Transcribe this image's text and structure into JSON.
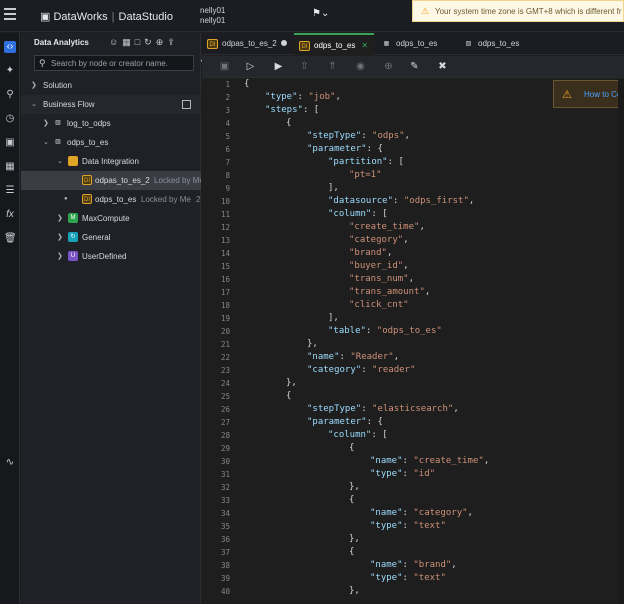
{
  "topbar": {
    "brand_product": "DataWorks",
    "brand_app": "DataStudio",
    "user_line1": "nelly01",
    "user_line2": "nelly01",
    "notice_text": "Your system time zone is GMT+8 which is different fr"
  },
  "sidebar": {
    "header": "Data Analytics",
    "search_placeholder": "Search by node or creator name.",
    "tree": [
      {
        "label": "Solution"
      },
      {
        "label": "Business Flow"
      },
      {
        "label": "log_to_odps"
      },
      {
        "label": "odps_to_es"
      },
      {
        "label": "Data Integration"
      },
      {
        "label": "odpas_to_es_2",
        "lock": "Locked by Me"
      },
      {
        "label": "odps_to_es",
        "lock": "Locked by Me",
        "suffix": "2"
      },
      {
        "label": "MaxCompute"
      },
      {
        "label": "General"
      },
      {
        "label": "UserDefined"
      }
    ]
  },
  "tabs": [
    {
      "label": "odpas_to_es_2",
      "icon": "DI"
    },
    {
      "label": "odps_to_es",
      "icon": "DI"
    },
    {
      "label": "odps_to_es",
      "icon": "table"
    },
    {
      "label": "odps_to_es",
      "icon": "flow"
    }
  ],
  "howto": {
    "label": "How to Co"
  },
  "editor": {
    "line_numbers": [
      "1",
      "2",
      "3",
      "4",
      "5",
      "6",
      "7",
      "8",
      "9",
      "10",
      "11",
      "12",
      "13",
      "14",
      "15",
      "16",
      "17",
      "18",
      "19",
      "20",
      "21",
      "22",
      "23",
      "24",
      "25",
      "26",
      "27",
      "28",
      "29",
      "30",
      "31",
      "32",
      "33",
      "34",
      "35",
      "36",
      "37",
      "38",
      "39",
      "40"
    ]
  },
  "colors": {
    "accent_green": "#3aa35b",
    "key": "#9cdcfe",
    "string": "#ce9178",
    "active_rail": "#2f6fe0"
  }
}
